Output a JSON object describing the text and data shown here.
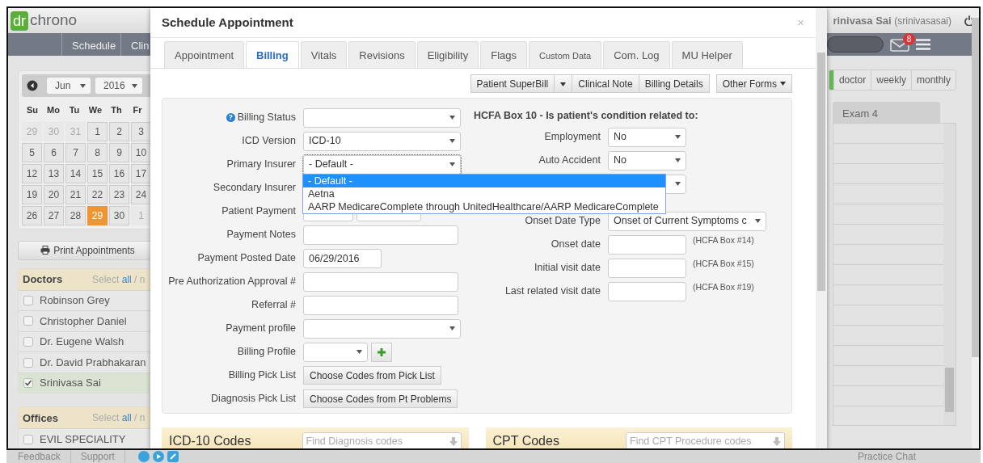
{
  "background": {
    "logo": {
      "badge": "dr",
      "text": "chrono"
    },
    "nav": [
      "Schedule",
      "Clin"
    ],
    "user": {
      "name": "rinivasa Sai",
      "handle": "(srinivasasai)"
    },
    "mail_count": "8",
    "calendar": {
      "month": "Jun",
      "year": "2016",
      "weekdays": [
        "Su",
        "Mo",
        "Tu",
        "We",
        "Th",
        "Fr"
      ],
      "weeks": [
        [
          {
            "day": "29",
            "muted": true,
            "selected": false
          },
          {
            "day": "30",
            "muted": true,
            "selected": false
          },
          {
            "day": "31",
            "muted": true,
            "selected": false
          },
          {
            "day": "1",
            "muted": false,
            "selected": false
          },
          {
            "day": "2",
            "muted": false,
            "selected": false
          },
          {
            "day": "3",
            "muted": false,
            "selected": false
          }
        ],
        [
          {
            "day": "5",
            "muted": false,
            "selected": false
          },
          {
            "day": "6",
            "muted": false,
            "selected": false
          },
          {
            "day": "7",
            "muted": false,
            "selected": false
          },
          {
            "day": "8",
            "muted": false,
            "selected": false
          },
          {
            "day": "9",
            "muted": false,
            "selected": false
          },
          {
            "day": "10",
            "muted": false,
            "selected": false
          }
        ],
        [
          {
            "day": "12",
            "muted": false,
            "selected": false
          },
          {
            "day": "13",
            "muted": false,
            "selected": false
          },
          {
            "day": "14",
            "muted": false,
            "selected": false
          },
          {
            "day": "15",
            "muted": false,
            "selected": false
          },
          {
            "day": "16",
            "muted": false,
            "selected": false
          },
          {
            "day": "17",
            "muted": false,
            "selected": false
          }
        ],
        [
          {
            "day": "19",
            "muted": false,
            "selected": false
          },
          {
            "day": "20",
            "muted": false,
            "selected": false
          },
          {
            "day": "21",
            "muted": false,
            "selected": false
          },
          {
            "day": "22",
            "muted": false,
            "selected": false
          },
          {
            "day": "23",
            "muted": false,
            "selected": false
          },
          {
            "day": "24",
            "muted": false,
            "selected": false
          }
        ],
        [
          {
            "day": "26",
            "muted": false,
            "selected": false
          },
          {
            "day": "27",
            "muted": false,
            "selected": false
          },
          {
            "day": "28",
            "muted": false,
            "selected": false
          },
          {
            "day": "29",
            "muted": false,
            "selected": true
          },
          {
            "day": "30",
            "muted": false,
            "selected": false
          },
          {
            "day": "1",
            "muted": true,
            "selected": false
          }
        ]
      ]
    },
    "print_button": "Print Appointments",
    "doctors": {
      "title": "Doctors",
      "select": "Select",
      "all": "all",
      "rest": "/ n",
      "items": [
        {
          "name": "Robinson Grey",
          "checked": false
        },
        {
          "name": "Christopher Daniel",
          "checked": false
        },
        {
          "name": "Dr. Eugene Walsh",
          "checked": false
        },
        {
          "name": "Dr. David Prabhakaran",
          "checked": false
        },
        {
          "name": "Srinivasa Sai",
          "checked": true
        }
      ]
    },
    "offices": {
      "title": "Offices",
      "select": "Select",
      "all": "all",
      "rest": "/ n",
      "items": [
        {
          "name": "EVIL SPECIALITY",
          "checked": false
        }
      ]
    },
    "views": [
      "doctor",
      "weekly",
      "monthly"
    ],
    "column": "Exam 4",
    "footer": {
      "links": [
        "Feedback",
        "Support"
      ],
      "chat": "Practice Chat"
    }
  },
  "modal": {
    "title": "Schedule Appointment",
    "close": "×",
    "tabs": [
      {
        "label": "Appointment",
        "selected": false
      },
      {
        "label": "Billing",
        "selected": true
      },
      {
        "label": "Vitals",
        "selected": false
      },
      {
        "label": "Revisions",
        "selected": false
      },
      {
        "label": "Eligibility",
        "selected": false
      },
      {
        "label": "Flags",
        "selected": false
      },
      {
        "label": "Custom Data",
        "selected": false
      },
      {
        "label": "Com. Log",
        "selected": false
      },
      {
        "label": "MU Helper",
        "selected": false
      }
    ],
    "toolbar": {
      "superbill": "Patient SuperBill",
      "clinical_note": "Clinical Note",
      "billing_details": "Billing Details",
      "other_forms": "Other Forms"
    },
    "left_fields": [
      {
        "label": "Billing Status",
        "kind": "select",
        "help": "?"
      },
      {
        "label": "ICD Version",
        "kind": "select",
        "value": "ICD-10"
      },
      {
        "label": "Primary Insurer",
        "kind": "select",
        "value": "- Default -",
        "focused": true
      },
      {
        "label": "Secondary Insurer",
        "kind": "hidden"
      },
      {
        "label": "Patient Payment",
        "kind": "pair"
      },
      {
        "label": "Payment Notes",
        "kind": "input"
      },
      {
        "label": "Payment Posted Date",
        "kind": "date",
        "value": "06/29/2016"
      },
      {
        "label": "Pre Authorization Approval #",
        "kind": "input"
      },
      {
        "label": "Referral #",
        "kind": "input"
      },
      {
        "label": "Payment profile",
        "kind": "select"
      },
      {
        "label": "Billing Profile",
        "kind": "select_add"
      },
      {
        "label": "Billing Pick List",
        "kind": "button",
        "value": "Choose Codes from Pick List"
      },
      {
        "label": "Diagnosis Pick List",
        "kind": "button",
        "value": "Choose Codes from Pt Problems"
      }
    ],
    "right_heading": "HCFA Box 10 - Is patient's condition related to:",
    "right_fields": [
      {
        "label": "Employment",
        "kind": "select",
        "value": "No"
      },
      {
        "label": "Auto Accident",
        "kind": "select",
        "value": "No"
      },
      {
        "kind": "select_covered"
      },
      {
        "label": "Onset Date Type",
        "kind": "select_wide",
        "value": "Onset of Current Symptoms c"
      },
      {
        "label": "Onset date",
        "kind": "date",
        "note": "(HCFA Box #14)"
      },
      {
        "label": "Initial visit date",
        "kind": "date",
        "note": "(HCFA Box #15)"
      },
      {
        "label": "Last related visit date",
        "kind": "date",
        "note": "(HCFA Box #19)"
      }
    ],
    "insurer_options": [
      {
        "label": "- Default -",
        "selected": true
      },
      {
        "label": "Aetna",
        "selected": false
      },
      {
        "label": "AARP MedicareComplete through UnitedHealthcare/AARP MedicareComplete",
        "selected": false
      }
    ],
    "code_sections": [
      {
        "title": "ICD-10 Codes",
        "placeholder": "Find Diagnosis codes"
      },
      {
        "title": "CPT Codes",
        "placeholder": "Find CPT Procedure codes"
      }
    ]
  }
}
